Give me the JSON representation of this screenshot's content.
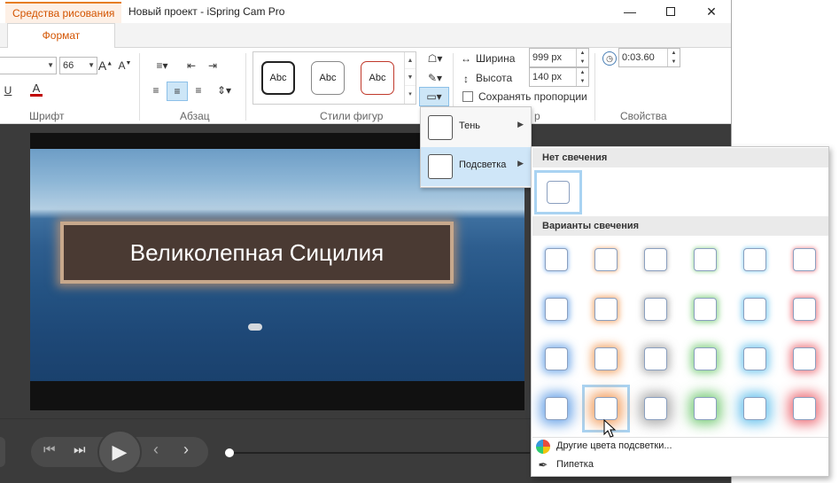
{
  "titlebar": {
    "context_tab": "Средства рисования",
    "title": "Новый проект - iSpring Cam Pro"
  },
  "ribbon_tab": "Формат",
  "font": {
    "name": "",
    "size": "66",
    "group_label": "Шрифт"
  },
  "paragraph": {
    "group_label": "Абзац"
  },
  "shape_styles": {
    "items": [
      "Abc",
      "Abc",
      "Abc"
    ],
    "group_label": "Стили фигур",
    "colors": [
      "#222222",
      "#888888",
      "#c0392b"
    ]
  },
  "size": {
    "width_label": "Ширина",
    "width_value": "999 px",
    "height_label": "Высота",
    "height_value": "140 px",
    "keep_ratio_label": "Сохранять пропорции",
    "group_label_partial": "р"
  },
  "properties": {
    "time_value": "0:03.60",
    "group_label": "Свойства"
  },
  "video": {
    "caption": "Великолепная Сицилия"
  },
  "effects_menu": [
    {
      "label": "Тень",
      "selected": false
    },
    {
      "label": "Подсветка",
      "selected": true
    }
  ],
  "glow_menu": {
    "none_header": "Нет свечения",
    "variants_header": "Варианты свечения",
    "glow_colors": [
      "#4a90e2",
      "#f08a3c",
      "#9a9a9a",
      "#5cc15c",
      "#4ab5e8",
      "#e8505b"
    ],
    "selected_row": 4,
    "selected_col": 2,
    "more_colors": "Другие цвета подсветки...",
    "eyedropper": "Пипетка"
  }
}
